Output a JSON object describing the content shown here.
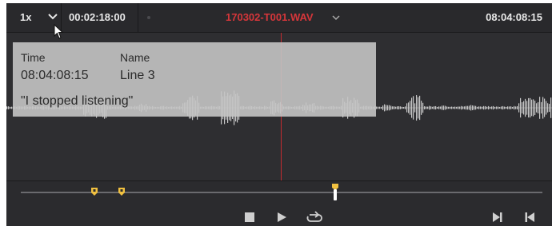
{
  "toolbar": {
    "speed": "1x",
    "timecode": "00:02:18:00",
    "clip_name": "170302-T001.WAV",
    "end_timecode": "08:04:08:15"
  },
  "marker_card": {
    "time_label": "Time",
    "name_label": "Name",
    "time_value": "08:04:08:15",
    "name_value": "Line 3",
    "note": "\"I stopped listening\""
  },
  "colors": {
    "accent_red": "#d6363a",
    "marker_yellow": "#f0c040",
    "panel_bg": "#2b2b2e"
  },
  "scrubber": {
    "playhead_fraction": 0.6,
    "marker_fractions": [
      0.14,
      0.19
    ]
  },
  "transport": {
    "icons": [
      "stop-icon",
      "play-icon",
      "loop-icon",
      "next-frame-icon",
      "previous-frame-icon"
    ]
  }
}
